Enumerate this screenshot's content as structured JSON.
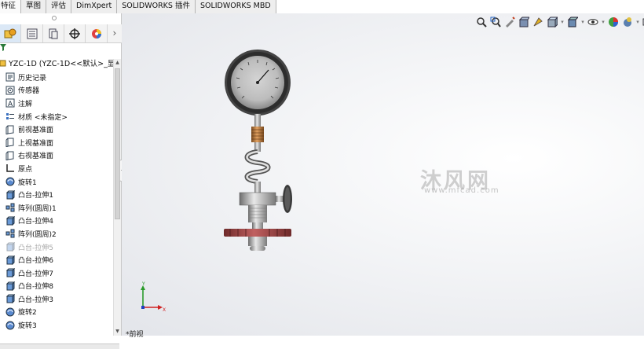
{
  "tabs": [
    "特征",
    "草图",
    "评估",
    "DimXpert",
    "SOLIDWORKS 插件",
    "SOLIDWORKS MBD"
  ],
  "feature_manager": {
    "tab_icons": [
      "feature-manager-icon",
      "property-manager-icon",
      "configuration-manager-icon",
      "dimxpert-manager-icon",
      "display-manager-icon"
    ],
    "more_glyph": "›",
    "root_label": "YZC-1D  (YZC-1D<<默认>_显示",
    "items": [
      {
        "label": "历史记录",
        "icon": "history-icon"
      },
      {
        "label": "传感器",
        "icon": "sensor-icon"
      },
      {
        "label": "注解",
        "icon": "annotation-icon"
      },
      {
        "label": "材质 <未指定>",
        "icon": "material-icon"
      },
      {
        "label": "前视基准面",
        "icon": "plane-icon"
      },
      {
        "label": "上视基准面",
        "icon": "plane-icon"
      },
      {
        "label": "右视基准面",
        "icon": "plane-icon"
      },
      {
        "label": "原点",
        "icon": "origin-icon"
      },
      {
        "label": "旋转1",
        "icon": "revolve-icon"
      },
      {
        "label": "凸台-拉伸1",
        "icon": "extrude-icon"
      },
      {
        "label": "阵列(圆周)1",
        "icon": "circular-pattern-icon"
      },
      {
        "label": "凸台-拉伸4",
        "icon": "extrude-icon"
      },
      {
        "label": "阵列(圆周)2",
        "icon": "circular-pattern-icon"
      },
      {
        "label": "凸台-拉伸5",
        "icon": "extrude-icon",
        "suppressed": true
      },
      {
        "label": "凸台-拉伸6",
        "icon": "extrude-icon"
      },
      {
        "label": "凸台-拉伸7",
        "icon": "extrude-icon"
      },
      {
        "label": "凸台-拉伸8",
        "icon": "extrude-icon"
      },
      {
        "label": "凸台-拉伸3",
        "icon": "extrude-icon"
      },
      {
        "label": "旋转2",
        "icon": "revolve-icon"
      },
      {
        "label": "旋转3",
        "icon": "revolve-icon"
      }
    ]
  },
  "heads_up_toolbar": [
    "zoom-to-fit-icon",
    "zoom-to-area-icon",
    "previous-view-icon",
    "section-view-icon",
    "dynamic-annotation-icon",
    "view-orientation-icon",
    "display-style-icon",
    "hide-show-icon",
    "edit-appearance-icon",
    "apply-scene-icon",
    "view-settings-icon"
  ],
  "watermark": {
    "main": "沐风网",
    "sub": "www.mfcad.com"
  },
  "triad": {
    "x": "X",
    "y": "Y"
  },
  "view_label": "*前视",
  "colors": {
    "accent": "#1f5fa8",
    "gauge_copper": "#b8753a",
    "flange_red": "#8c3a3a"
  }
}
